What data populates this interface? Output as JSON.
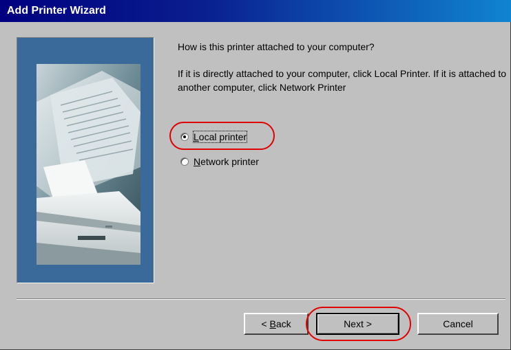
{
  "window": {
    "title": "Add Printer Wizard"
  },
  "content": {
    "question": "How is this printer attached to your computer?",
    "instructions": "If it is directly attached to your computer, click Local Printer. If it is attached to another computer, click Network Printer"
  },
  "options": {
    "local": {
      "label_accel": "L",
      "label_rest": "ocal printer",
      "selected": true
    },
    "network": {
      "label_accel": "N",
      "label_rest": "etwork printer",
      "selected": false
    }
  },
  "buttons": {
    "back_prefix": "< ",
    "back_accel": "B",
    "back_rest": "ack",
    "next": "Next >",
    "cancel": "Cancel"
  },
  "colors": {
    "titlebar_start": "#000080",
    "titlebar_end": "#1084d0",
    "highlight": "#e00000",
    "panel": "#3a6a9a"
  }
}
